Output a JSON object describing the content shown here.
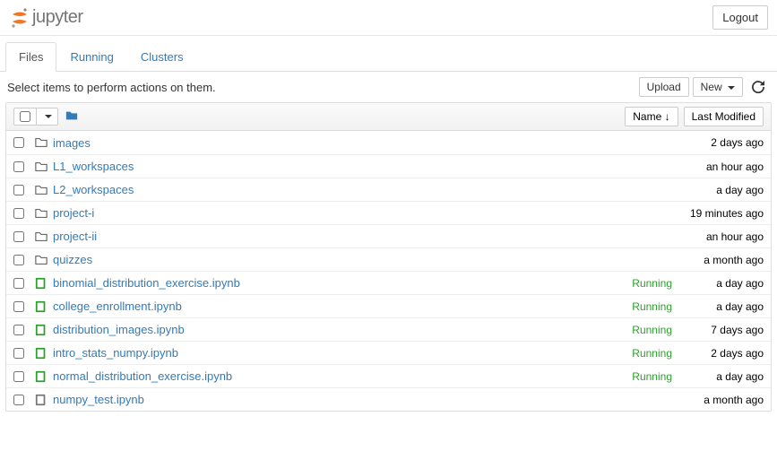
{
  "header": {
    "brand": "jupyter",
    "logout": "Logout"
  },
  "tabs": [
    {
      "label": "Files",
      "active": true
    },
    {
      "label": "Running",
      "active": false
    },
    {
      "label": "Clusters",
      "active": false
    }
  ],
  "toolbar": {
    "hint": "Select items to perform actions on them.",
    "upload": "Upload",
    "new": "New"
  },
  "list_header": {
    "name_col": "Name",
    "modified_col": "Last Modified"
  },
  "items": [
    {
      "type": "folder",
      "name": "images",
      "status": "",
      "modified": "2 days ago",
      "name_style": "big"
    },
    {
      "type": "folder",
      "name": "L1_workspaces",
      "status": "",
      "modified": "an hour ago"
    },
    {
      "type": "folder",
      "name": "L2_workspaces",
      "status": "",
      "modified": "a day ago"
    },
    {
      "type": "folder",
      "name": "project-i",
      "status": "",
      "modified": "19 minutes ago"
    },
    {
      "type": "folder",
      "name": "project-ii",
      "status": "",
      "modified": "an hour ago"
    },
    {
      "type": "folder",
      "name": "quizzes",
      "status": "",
      "modified": "a month ago"
    },
    {
      "type": "nb_running",
      "name": "binomial_distribution_exercise.ipynb",
      "status": "Running",
      "modified": "a day ago"
    },
    {
      "type": "nb_running",
      "name": "college_enrollment.ipynb",
      "status": "Running",
      "modified": "a day ago"
    },
    {
      "type": "nb_running",
      "name": "distribution_images.ipynb",
      "status": "Running",
      "modified": "7 days ago"
    },
    {
      "type": "nb_running",
      "name": "intro_stats_numpy.ipynb",
      "status": "Running",
      "modified": "2 days ago"
    },
    {
      "type": "nb_running",
      "name": "normal_distribution_exercise.ipynb",
      "status": "Running",
      "modified": "a day ago"
    },
    {
      "type": "nb",
      "name": "numpy_test.ipynb",
      "status": "",
      "modified": "a month ago"
    }
  ]
}
